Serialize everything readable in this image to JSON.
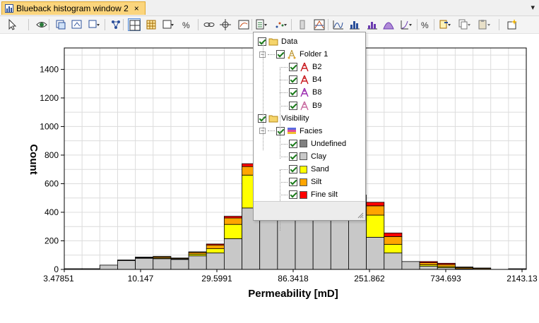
{
  "window": {
    "tab_title": "Blueback histogram window 2",
    "close_glyph": "×",
    "pin_glyph": "▾"
  },
  "toolbar": {
    "buttons": [
      {
        "name": "select-pointer-button",
        "icon": "cursor-icon"
      },
      {
        "name": "view-eye-button",
        "icon": "eye-icon"
      },
      {
        "name": "zoom-in-button",
        "icon": "zoom-in-icon"
      },
      {
        "name": "zoom-window-button",
        "icon": "zoom-window-icon"
      },
      {
        "name": "zoom-options-button",
        "icon": "zoom-dropdown-icon"
      },
      {
        "name": "link-nodes-button",
        "icon": "network-icon"
      },
      {
        "name": "grid-toggle-button",
        "icon": "grid-icon"
      },
      {
        "name": "table-button",
        "icon": "table-icon"
      },
      {
        "name": "frame-options-button",
        "icon": "frame-icon"
      },
      {
        "name": "percent-options-button",
        "icon": "percent-icon"
      },
      {
        "name": "link-button",
        "icon": "chain-icon"
      },
      {
        "name": "crosshair-button",
        "icon": "crosshair-icon"
      },
      {
        "name": "legend-button",
        "icon": "legend-icon"
      },
      {
        "name": "data-filter-button",
        "icon": "checklist-icon"
      },
      {
        "name": "scatter-options-button",
        "icon": "scatter-icon"
      },
      {
        "name": "bar-button",
        "icon": "bar-icon"
      },
      {
        "name": "palette-button",
        "icon": "palette-icon"
      },
      {
        "name": "curve-button",
        "icon": "curve-icon"
      },
      {
        "name": "histogram-button",
        "icon": "histogram-icon"
      },
      {
        "name": "histogram-alt-button",
        "icon": "histogram-alt-icon"
      },
      {
        "name": "bell-curve-button",
        "icon": "bell-curve-icon"
      },
      {
        "name": "cumulative-button",
        "icon": "cumulative-icon"
      },
      {
        "name": "percent-disabled-button",
        "icon": "percent-icon"
      },
      {
        "name": "export-button",
        "icon": "export-icon"
      },
      {
        "name": "copy-button",
        "icon": "copy-icon"
      },
      {
        "name": "paste-button",
        "icon": "paste-icon"
      },
      {
        "name": "new-window-button",
        "icon": "sparkle-icon"
      }
    ]
  },
  "chart_data": {
    "type": "bar",
    "stacked": true,
    "xlabel": "Permeability [mD]",
    "ylabel": "Count",
    "x_scale": "log",
    "ylim": [
      0,
      1550
    ],
    "y_ticks": [
      0,
      200,
      400,
      600,
      800,
      1000,
      1200,
      1400
    ],
    "x_tick_labels": [
      "3.47851",
      "10.147",
      "29.5991",
      "86.3418",
      "251.862",
      "734.693",
      "2143.13"
    ],
    "grid": true,
    "series": [
      {
        "name": "Undefined",
        "color": "#808080",
        "values": [
          0,
          0,
          0,
          0,
          0,
          0,
          0,
          0,
          0,
          0,
          0,
          0,
          0,
          0,
          0,
          0,
          0,
          0,
          0,
          0,
          0,
          0,
          0,
          0,
          0,
          0
        ]
      },
      {
        "name": "Clay",
        "color": "#c8c8c8",
        "values": [
          5,
          5,
          30,
          62,
          78,
          75,
          70,
          95,
          115,
          215,
          430,
          610,
          700,
          810,
          790,
          640,
          520,
          225,
          115,
          55,
          22,
          12,
          5,
          2,
          0,
          5
        ]
      },
      {
        "name": "Sand",
        "color": "#ffff00",
        "values": [
          0,
          0,
          0,
          2,
          3,
          5,
          4,
          12,
          30,
          100,
          230,
          0,
          0,
          0,
          0,
          0,
          0,
          155,
          60,
          0,
          10,
          8,
          0,
          0,
          0,
          0
        ]
      },
      {
        "name": "Silt",
        "color": "#ffa500",
        "values": [
          0,
          0,
          0,
          2,
          4,
          8,
          5,
          12,
          25,
          45,
          60,
          0,
          0,
          0,
          0,
          0,
          0,
          65,
          55,
          0,
          15,
          15,
          8,
          6,
          0,
          0
        ]
      },
      {
        "name": "Fine silt",
        "color": "#ff0000",
        "values": [
          0,
          0,
          0,
          0,
          1,
          3,
          1,
          4,
          8,
          12,
          20,
          0,
          0,
          0,
          0,
          0,
          0,
          25,
          25,
          0,
          8,
          8,
          4,
          2,
          0,
          0
        ]
      }
    ]
  },
  "popup": {
    "items": [
      {
        "label": "Data",
        "icon": "folder-icon"
      },
      {
        "label": "Folder 1",
        "icon": "well-folder-icon"
      },
      {
        "label": "B2",
        "icon": "well-icon"
      },
      {
        "label": "B4",
        "icon": "well-icon"
      },
      {
        "label": "B8",
        "icon": "well-icon"
      },
      {
        "label": "B9",
        "icon": "well-icon"
      },
      {
        "label": "Visibility",
        "icon": "folder-icon"
      },
      {
        "label": "Facies",
        "icon": "facies-icon"
      },
      {
        "label": "Undefined",
        "color": "#808080"
      },
      {
        "label": "Clay",
        "color": "#c8c8c8"
      },
      {
        "label": "Sand",
        "color": "#ffff00"
      },
      {
        "label": "Silt",
        "color": "#ffa500"
      },
      {
        "label": "Fine silt",
        "color": "#ff0000"
      }
    ]
  }
}
